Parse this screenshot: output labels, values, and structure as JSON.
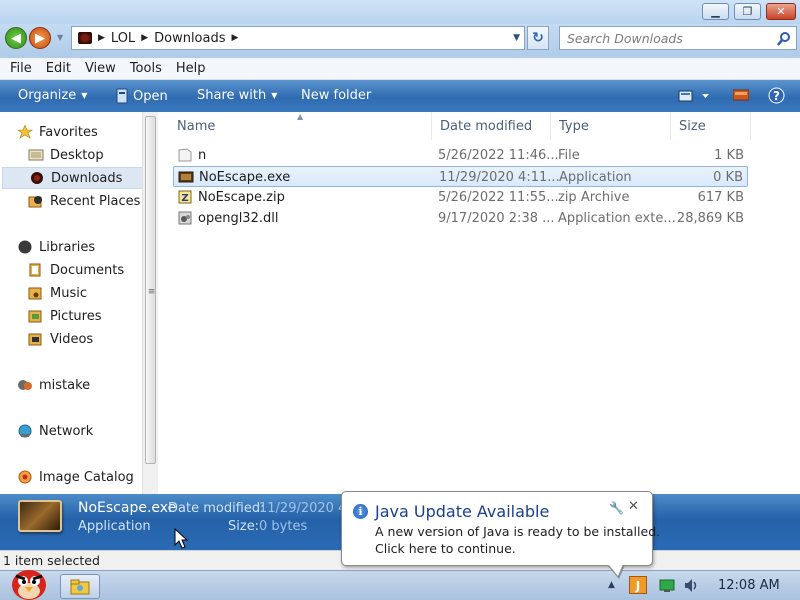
{
  "address": {
    "crumbs": [
      "LOL",
      "Downloads"
    ],
    "search_placeholder": "Search Downloads"
  },
  "menu": [
    "File",
    "Edit",
    "View",
    "Tools",
    "Help"
  ],
  "commands": {
    "organize": "Organize",
    "open": "Open",
    "share_with": "Share with",
    "new_folder": "New folder"
  },
  "sidebar": {
    "items": [
      {
        "label": "Favorites"
      },
      {
        "label": "Desktop"
      },
      {
        "label": "Downloads",
        "selected": true
      },
      {
        "label": "Recent Places"
      },
      {
        "label": "Libraries"
      },
      {
        "label": "Documents"
      },
      {
        "label": "Music"
      },
      {
        "label": "Pictures"
      },
      {
        "label": "Videos"
      },
      {
        "label": "mistake"
      },
      {
        "label": "Network"
      },
      {
        "label": "Image Catalog"
      }
    ]
  },
  "columns": {
    "name": "Name",
    "date": "Date modified",
    "type": "Type",
    "size": "Size"
  },
  "files": [
    {
      "name": "n",
      "date": "5/26/2022 11:46...",
      "type": "File",
      "size": "1 KB"
    },
    {
      "name": "NoEscape.exe",
      "date": "11/29/2020 4:11...",
      "type": "Application",
      "size": "0 KB",
      "selected": true
    },
    {
      "name": "NoEscape.zip",
      "date": "5/26/2022 11:55...",
      "type": "zip Archive",
      "size": "617 KB"
    },
    {
      "name": "opengl32.dll",
      "date": "9/17/2020 2:38 ...",
      "type": "Application exte...",
      "size": "28,869 KB"
    }
  ],
  "details": {
    "name": "NoEscape.exe",
    "type": "Application",
    "date_label": "Date modified:",
    "date_value": "11/29/2020 4:",
    "size_label": "Size:",
    "size_value": "0 bytes"
  },
  "status": "1 item selected",
  "balloon": {
    "title": "Java Update Available",
    "line1": "A new version of Java is ready to be installed.",
    "line2": "Click here to continue."
  },
  "clock": "12:08 AM",
  "colors": {
    "command_bar": "#2f6bb0",
    "selection": "#d8e9fb",
    "balloon_title": "#1a3f8f"
  }
}
